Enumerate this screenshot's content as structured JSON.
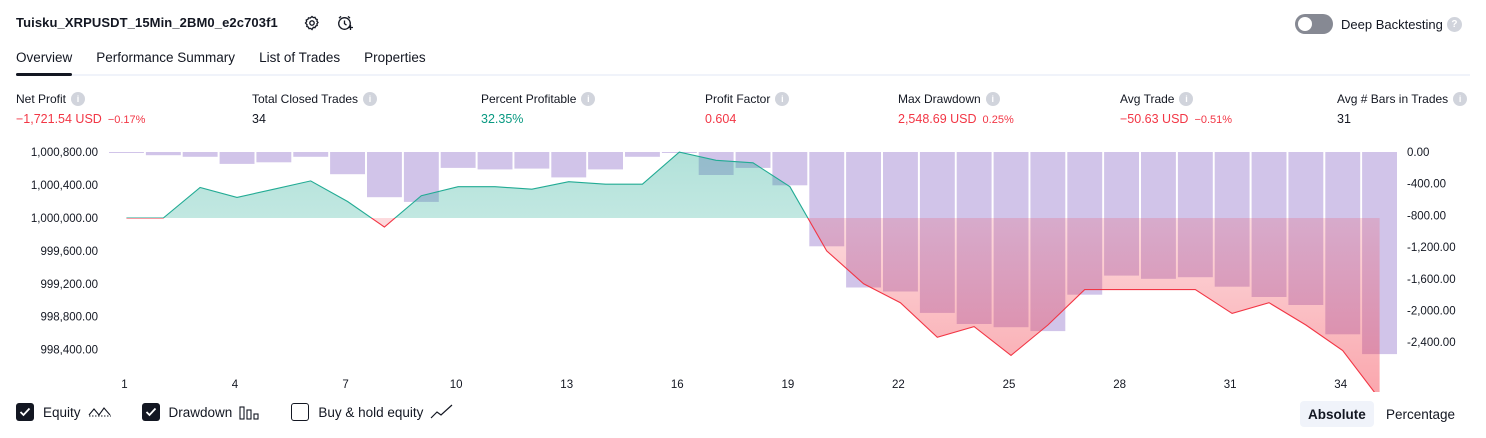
{
  "header": {
    "strategy_name": "Tuisku_XRPUSDT_15Min_2BM0_e2c703f1",
    "settings_icon": "gear-icon",
    "alert_icon": "add-alert-icon",
    "deep_backtesting_label": "Deep Backtesting",
    "deep_backtesting_enabled": false,
    "help_glyph": "?"
  },
  "tabs": [
    {
      "label": "Overview",
      "active": true
    },
    {
      "label": "Performance Summary",
      "active": false
    },
    {
      "label": "List of Trades",
      "active": false
    },
    {
      "label": "Properties",
      "active": false
    }
  ],
  "metrics": [
    {
      "label": "Net Profit",
      "value": "−1,721.54 USD",
      "sub": "−0.17%",
      "tone": "neg"
    },
    {
      "label": "Total Closed Trades",
      "value": "34",
      "sub": "",
      "tone": "neu"
    },
    {
      "label": "Percent Profitable",
      "value": "32.35%",
      "sub": "",
      "tone": "pos"
    },
    {
      "label": "Profit Factor",
      "value": "0.604",
      "sub": "",
      "tone": "neg"
    },
    {
      "label": "Max Drawdown",
      "value": "2,548.69 USD",
      "sub": "0.25%",
      "tone": "neg"
    },
    {
      "label": "Avg Trade",
      "value": "−50.63 USD",
      "sub": "−0.51%",
      "tone": "neg"
    },
    {
      "label": "Avg # Bars in Trades",
      "value": "31",
      "sub": "",
      "tone": "neu"
    }
  ],
  "chart_data": {
    "type": "line",
    "x": [
      1,
      2,
      3,
      4,
      5,
      6,
      7,
      8,
      9,
      10,
      11,
      12,
      13,
      14,
      15,
      16,
      17,
      18,
      19,
      20,
      21,
      22,
      23,
      24,
      25,
      26,
      27,
      28,
      29,
      30,
      31,
      32,
      33,
      34,
      35
    ],
    "x_ticks": [
      1,
      4,
      7,
      10,
      13,
      16,
      19,
      22,
      25,
      28,
      31,
      34
    ],
    "series": [
      {
        "name": "Equity",
        "axis": "left",
        "baseline": 1000000,
        "color_up": "#22ab94",
        "color_down": "#f23645",
        "values": [
          1000000,
          1000000,
          1000370,
          1000250,
          1000350,
          1000450,
          1000200,
          999890,
          1000270,
          1000380,
          1000380,
          1000350,
          1000440,
          1000410,
          1000410,
          1000800,
          1000700,
          1000670,
          1000380,
          999600,
          999200,
          998970,
          998550,
          998680,
          998330,
          998700,
          999130,
          999130,
          999130,
          999130,
          998840,
          998970,
          998700,
          998390,
          997800
        ]
      },
      {
        "name": "Drawdown",
        "axis": "right",
        "type": "bar",
        "color": "#d1c4e9",
        "values": [
          0,
          -40,
          -60,
          -150,
          -130,
          -60,
          -280,
          -570,
          -630,
          -200,
          -220,
          -210,
          -320,
          -220,
          -60,
          0,
          -290,
          -200,
          -420,
          -1190,
          -1710,
          -1760,
          -2030,
          -2170,
          -2210,
          -2260,
          -1800,
          -1560,
          -1600,
          -1580,
          -1700,
          -1830,
          -1930,
          -2300,
          -2550
        ]
      }
    ],
    "ylim_left": [
      998250,
      1000850
    ],
    "yticks_left": [
      "1,000,800.00",
      "1,000,400.00",
      "1,000,000.00",
      "999,600.00",
      "999,200.00",
      "998,800.00",
      "998,400.00"
    ],
    "yticks_left_values": [
      1000800,
      1000400,
      1000000,
      999600,
      999200,
      998800,
      998400
    ],
    "ylim_right": [
      -2650,
      50
    ],
    "yticks_right": [
      "0.00",
      "-400.00",
      "-800.00",
      "-1,200.00",
      "-1,600.00",
      "-2,000.00",
      "-2,400.00"
    ],
    "yticks_right_values": [
      0,
      -400,
      -800,
      -1200,
      -1600,
      -2000,
      -2400
    ],
    "grid": false
  },
  "legend": [
    {
      "label": "Equity",
      "checked": true,
      "icon": "equity-line-icon"
    },
    {
      "label": "Drawdown",
      "checked": true,
      "icon": "drawdown-bars-icon"
    },
    {
      "label": "Buy & hold equity",
      "checked": false,
      "icon": "buy-hold-line-icon"
    }
  ],
  "modes": [
    {
      "label": "Absolute",
      "active": true
    },
    {
      "label": "Percentage",
      "active": false
    }
  ]
}
